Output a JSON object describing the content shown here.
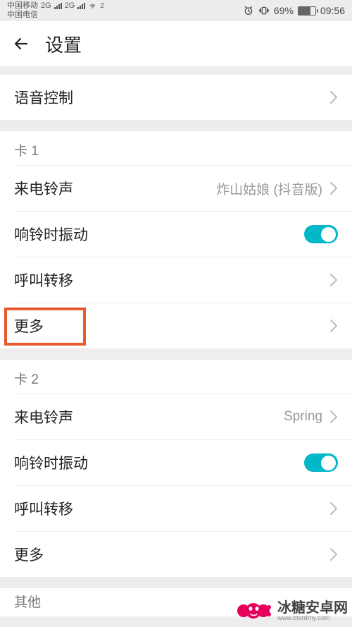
{
  "status": {
    "carrier1": "中国移动",
    "net1": "2G",
    "carrier2": "中国电信",
    "net2": "2G",
    "wifi_sup": "2",
    "battery_pct": "69%",
    "time": "09:56"
  },
  "header": {
    "title": "设置"
  },
  "top_row": {
    "label": "语音控制"
  },
  "card1": {
    "header": "卡 1",
    "ringtone_label": "来电铃声",
    "ringtone_value": "炸山姑娘 (抖音版)",
    "vibrate_label": "响铃时振动",
    "vibrate_on": true,
    "forward_label": "呼叫转移",
    "more_label": "更多"
  },
  "card2": {
    "header": "卡 2",
    "ringtone_label": "来电铃声",
    "ringtone_value": "Spring",
    "vibrate_label": "响铃时振动",
    "vibrate_on": true,
    "forward_label": "呼叫转移",
    "more_label": "更多"
  },
  "other": {
    "header": "其他"
  },
  "watermark": {
    "cn": "冰糖安卓网",
    "en": "www.btxtdmy.com"
  }
}
